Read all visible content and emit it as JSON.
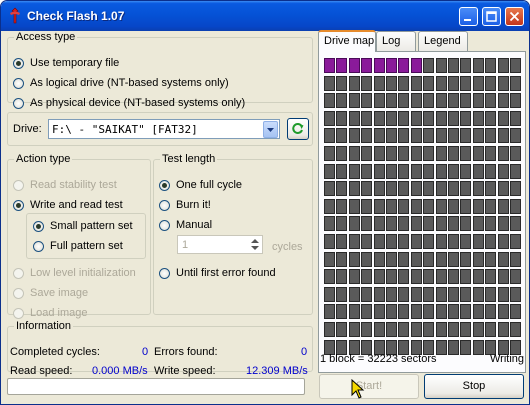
{
  "window": {
    "title": "Check Flash 1.07"
  },
  "titlebar_buttons": [
    "minimize-icon",
    "maximize-icon",
    "close-icon"
  ],
  "access": {
    "legend": "Access type",
    "options": [
      "Use temporary file",
      "As logical drive (NT-based systems only)",
      "As physical device (NT-based systems only)"
    ],
    "selected": 0
  },
  "drive": {
    "label": "Drive:",
    "value": "F:\\ - \"SAIKAT\" [FAT32]"
  },
  "action": {
    "legend": "Action type",
    "read_stability": "Read stability test",
    "write_read": "Write and read test",
    "small_pattern": "Small pattern set",
    "full_pattern": "Full pattern set",
    "low_level": "Low level initialization",
    "save_image": "Save image",
    "load_image": "Load image"
  },
  "test_length": {
    "legend": "Test length",
    "one_cycle": "One full cycle",
    "burn": "Burn it!",
    "manual": "Manual",
    "cycles_value": "1",
    "cycles_label": "cycles",
    "until_error": "Until first error found"
  },
  "info": {
    "legend": "Information",
    "completed_label": "Completed cycles:",
    "completed_value": "0",
    "errors_label": "Errors found:",
    "errors_value": "0",
    "read_label": "Read speed:",
    "read_value": "0.000 MB/s",
    "write_label": "Write speed:",
    "write_value": "12.309 MB/s"
  },
  "tabs": [
    "Drive map",
    "Log",
    "Legend"
  ],
  "drive_map": {
    "block_info": "1 block = 32223 sectors",
    "status": "Writing",
    "cols": 16,
    "rows": 17,
    "used_blocks": 8
  },
  "buttons": {
    "start": "Start!",
    "stop": "Stop"
  },
  "progress": 0,
  "colors": {
    "used_block": "#8a1a9a",
    "free_block": "#5a5a5a",
    "value_text": "#0000cc"
  }
}
